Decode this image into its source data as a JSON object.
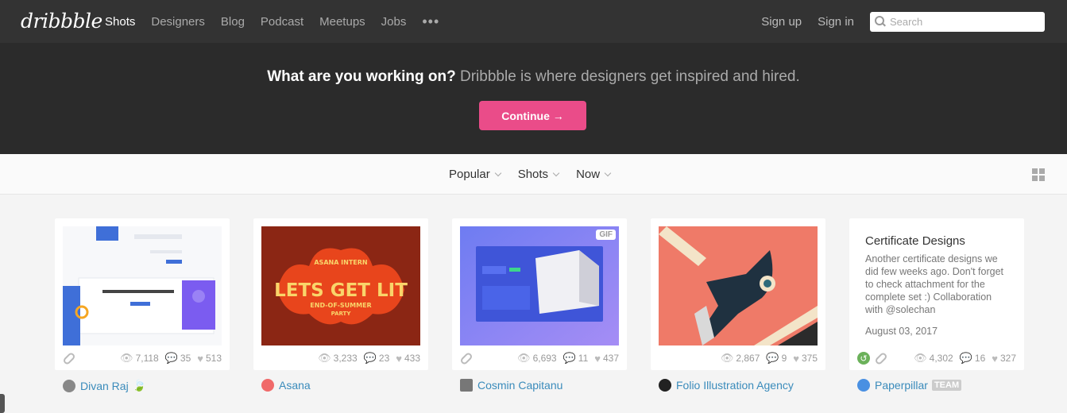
{
  "nav": {
    "logo": "dribbble",
    "links": [
      "Shots",
      "Designers",
      "Blog",
      "Podcast",
      "Meetups",
      "Jobs"
    ],
    "more": "•••",
    "signup": "Sign up",
    "signin": "Sign in",
    "search_placeholder": "Search"
  },
  "hero": {
    "lead": "What are you working on?",
    "text": " Dribbble is where designers get inspired and hired.",
    "cta": "Continue →"
  },
  "filters": {
    "sort": "Popular",
    "type": "Shots",
    "time": "Now"
  },
  "shots": [
    {
      "views": "7,118",
      "comments": "35",
      "likes": "513",
      "author": "Divan Raj",
      "avatar_color": "#888888"
    },
    {
      "views": "3,233",
      "comments": "23",
      "likes": "433",
      "author": "Asana",
      "avatar_color": "#f06a6a",
      "art_lines": [
        "ASANA INTERN",
        "LETS GET LIT",
        "END-OF-SUMMER",
        "PARTY"
      ]
    },
    {
      "views": "6,693",
      "comments": "11",
      "likes": "437",
      "author": "Cosmin Capitanu",
      "avatar_color": "#777777",
      "gif": "GIF"
    },
    {
      "views": "2,867",
      "comments": "9",
      "likes": "375",
      "author": "Folio Illustration Agency",
      "avatar_color": "#222222"
    },
    {
      "views": "4,302",
      "comments": "16",
      "likes": "327",
      "author": "Paperpillar",
      "avatar_color": "#4a90e2",
      "badge": "TEAM",
      "title": "Certificate Designs",
      "description": "Another certificate designs we did few weeks ago. Don't forget to check attachment for the complete set :) Collaboration with @solechan",
      "date": "August 03, 2017"
    }
  ],
  "colors": {
    "accent": "#ea4c89",
    "nav_bg": "#333333",
    "hero_bg": "#2b2b2b",
    "link": "#3a8bbb"
  }
}
